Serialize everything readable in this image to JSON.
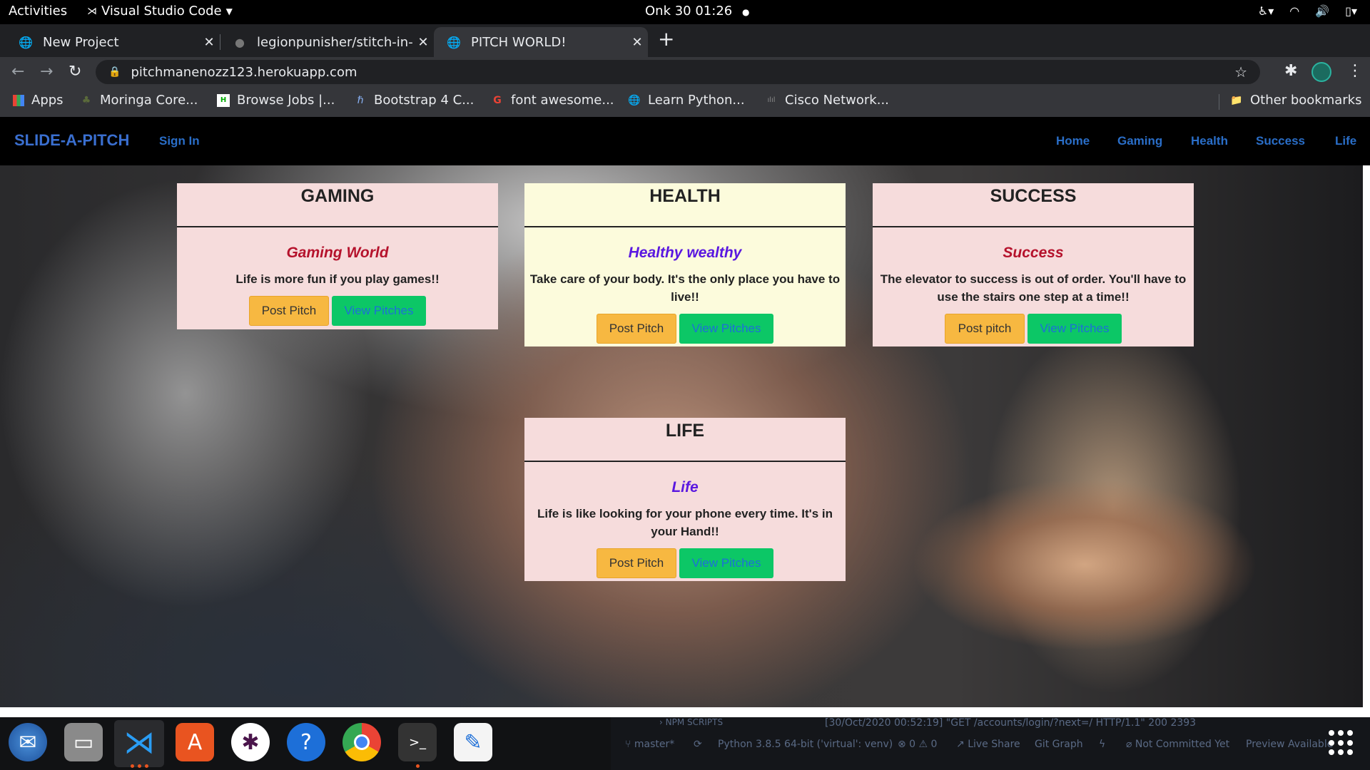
{
  "topbar": {
    "activities": "Activities",
    "app_name": "Visual Studio Code",
    "clock": "Onk 30  01:26"
  },
  "tabs": [
    {
      "title": "New Project",
      "icon": "globe-icon"
    },
    {
      "title": "legionpunisher/stitch-in-t",
      "icon": "github-icon"
    },
    {
      "title": "PITCH WORLD!",
      "icon": "globe-icon"
    }
  ],
  "omnibox": {
    "url": "pitchmanenozz123.herokuapp.com"
  },
  "bookmarks": {
    "items": [
      {
        "label": "Apps",
        "icon": "apps-grid-icon"
      },
      {
        "label": "Moringa Core...",
        "icon": "moringa-icon"
      },
      {
        "label": "Browse Jobs |...",
        "icon": "jobs-icon"
      },
      {
        "label": "Bootstrap 4 C...",
        "icon": "bootstrap-icon"
      },
      {
        "label": "font awesome...",
        "icon": "google-icon"
      },
      {
        "label": "Learn Python...",
        "icon": "globe-icon"
      },
      {
        "label": "Cisco Network...",
        "icon": "cisco-icon"
      }
    ],
    "other": "Other bookmarks"
  },
  "site": {
    "brand": "SLIDE-A-PITCH",
    "sign_in": "Sign In",
    "links": [
      "Home",
      "Gaming",
      "Health",
      "Success",
      "Life"
    ]
  },
  "cards": {
    "gaming": {
      "heading": "GAMING",
      "subtitle": "Gaming World",
      "text": "Life is more fun if you play games!!",
      "post": "Post Pitch",
      "view": "View Pitches"
    },
    "health": {
      "heading": "HEALTH",
      "subtitle": "Healthy wealthy",
      "text": "Take care of your body. It's the only place you have to live!!",
      "post": "Post Pitch",
      "view": "View Pitches"
    },
    "success": {
      "heading": "SUCCESS",
      "subtitle": "Success",
      "text": "The elevator to success is out of order. You'll have to use the stairs one step at a time!!",
      "post": "Post pitch",
      "view": "View Pitches"
    },
    "life": {
      "heading": "LIFE",
      "subtitle": "Life",
      "text": "Life is like looking for your phone every time. It's in your Hand!!",
      "post": "Post Pitch",
      "view": "View Pitches"
    }
  },
  "colors": {
    "brand": "#3a6fd0",
    "subtitle_red": "#b5122c",
    "subtitle_purple": "#5a18e0",
    "post_button": "#f7b841",
    "view_button": "#0cc766"
  },
  "vscode_status": {
    "npm": "NPM SCRIPTS",
    "log": "[30/Oct/2020 00:52:19] \"GET /accounts/login/?next=/ HTTP/1.1\" 200 2393",
    "branch": "master*",
    "python": "Python 3.8.5 64-bit ('virtual': venv)",
    "problems": "⊗ 0 ⚠ 0",
    "live_share": "Live Share",
    "git_graph": "Git Graph",
    "commit": "Not Committed Yet",
    "preview": "Preview Available"
  }
}
